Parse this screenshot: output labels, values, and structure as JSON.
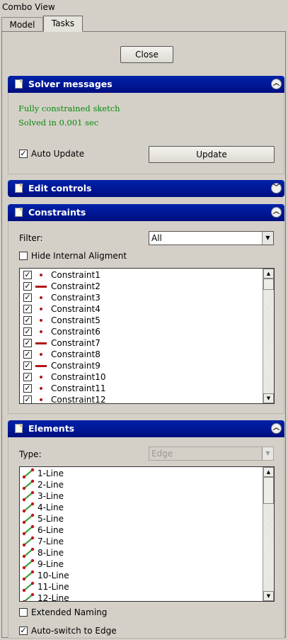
{
  "window": {
    "title": "Combo View"
  },
  "tabs": [
    {
      "label": "Model"
    },
    {
      "label": "Tasks"
    }
  ],
  "close_label": "Close",
  "solver": {
    "title": "Solver messages",
    "status": "Fully constrained sketch",
    "time": "Solved in 0.001 sec",
    "auto_update_label": "Auto Update",
    "auto_update_checked": true,
    "update_label": "Update"
  },
  "edit_controls": {
    "title": "Edit controls"
  },
  "constraints": {
    "title": "Constraints",
    "filter_label": "Filter:",
    "filter_value": "All",
    "hide_internal_label": "Hide Internal Aligment",
    "hide_internal_checked": false,
    "items": [
      {
        "name": "Constraint1",
        "icon": "point"
      },
      {
        "name": "Constraint2",
        "icon": "line"
      },
      {
        "name": "Constraint3",
        "icon": "point"
      },
      {
        "name": "Constraint4",
        "icon": "point"
      },
      {
        "name": "Constraint5",
        "icon": "point"
      },
      {
        "name": "Constraint6",
        "icon": "point"
      },
      {
        "name": "Constraint7",
        "icon": "line"
      },
      {
        "name": "Constraint8",
        "icon": "point"
      },
      {
        "name": "Constraint9",
        "icon": "line"
      },
      {
        "name": "Constraint10",
        "icon": "point"
      },
      {
        "name": "Constraint11",
        "icon": "point"
      },
      {
        "name": "Constraint12",
        "icon": "point"
      }
    ]
  },
  "elements": {
    "title": "Elements",
    "type_label": "Type:",
    "type_value": "Edge",
    "items": [
      {
        "name": "1-Line"
      },
      {
        "name": "2-Line"
      },
      {
        "name": "3-Line"
      },
      {
        "name": "4-Line"
      },
      {
        "name": "5-Line"
      },
      {
        "name": "6-Line"
      },
      {
        "name": "7-Line"
      },
      {
        "name": "8-Line"
      },
      {
        "name": "9-Line"
      },
      {
        "name": "10-Line"
      },
      {
        "name": "11-Line"
      },
      {
        "name": "12-Line"
      }
    ],
    "extended_naming_label": "Extended Naming",
    "extended_naming_checked": false,
    "auto_switch_label": "Auto-switch to Edge",
    "auto_switch_checked": true
  },
  "colors": {
    "header": "#000e80",
    "message": "#0a8a0a",
    "constraint_red": "#b01818"
  }
}
